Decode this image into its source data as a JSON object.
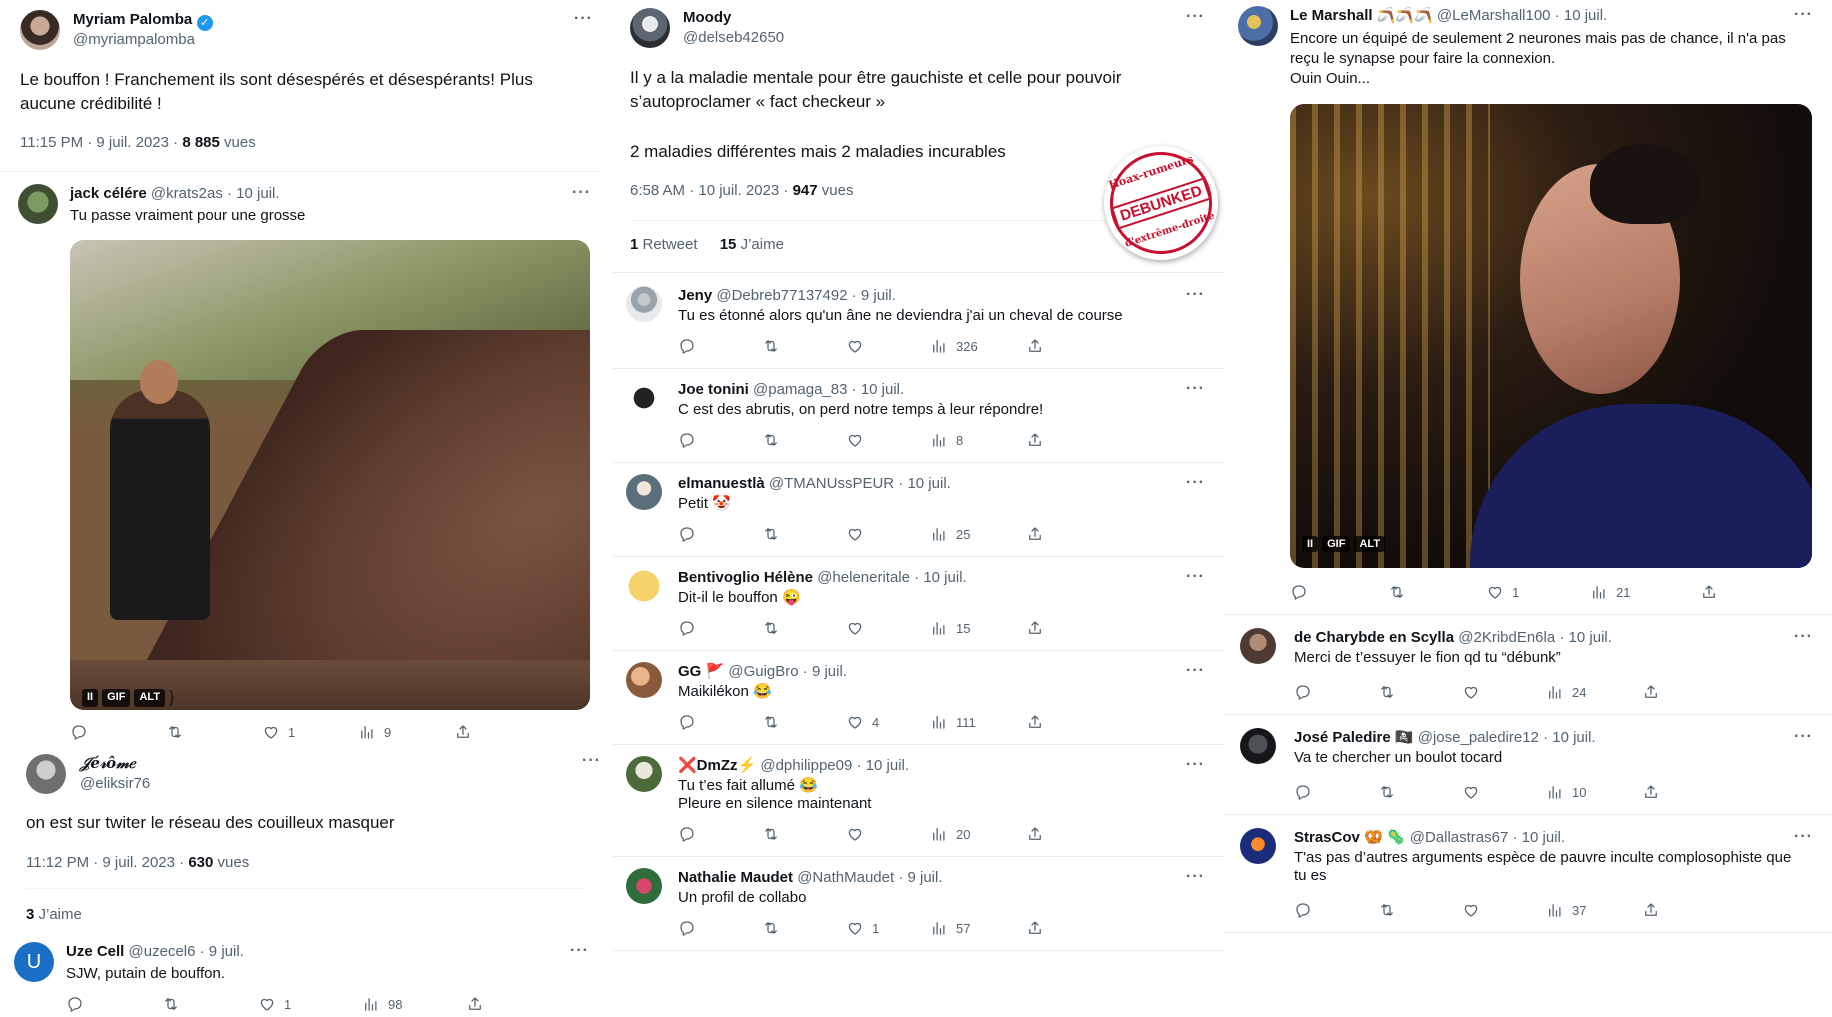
{
  "col1": {
    "main": {
      "name": "Myriam Palomba",
      "handle": "@myriampalomba",
      "text": "Le bouffon ! Franchement ils sont désespérés et désespérants! Plus aucune crédibilité !",
      "time": "11:15 PM · 9 juil. 2023 · ",
      "views_num": "8 885",
      "views_label": " vues"
    },
    "reply1": {
      "name": "jack célére",
      "handle": "@krats2as",
      "date": "· 10 juil.",
      "text": "Tu passe vraiment pour une grosse",
      "likes": "1",
      "views": "9",
      "badge": [
        "II",
        "GIF",
        "ALT"
      ]
    },
    "main2": {
      "name": "𝒥é𝓇ô𝓂𝑒",
      "handle": "@eliksir76",
      "text": "on est sur twiter le réseau des couilleux masquer",
      "time": "11:12 PM · 9 juil. 2023 · ",
      "views_num": "630",
      "views_label": " vues",
      "likes_num": "3",
      "likes_label": " J’aime"
    },
    "reply2": {
      "avatar_letter": "U",
      "name": "Uze Cell",
      "handle": "@uzecel6",
      "date": "· 9 juil.",
      "text": "SJW, putain de bouffon.",
      "likes": "1",
      "views": "98"
    }
  },
  "col2": {
    "main": {
      "name": "Moody",
      "handle": "@delseb42650",
      "text1": "Il y a la maladie mentale pour être gauchiste et celle pour pouvoir s’autoproclamer « fact checkeur »",
      "text2": "2 maladies différentes mais 2 maladies incurables",
      "time": "6:58 AM · 10 juil. 2023 · ",
      "views_num": "947",
      "views_label": " vues",
      "rt_num": "1",
      "rt_label": " Retweet",
      "likes_num": "15",
      "likes_label": " J’aime",
      "stamp_top": "Hoax-rumeurs",
      "stamp_mid": "DEBUNKED",
      "stamp_bot": "d'extrême-droite"
    },
    "replies": [
      {
        "name": "Jeny",
        "handle": "@Debreb77137492",
        "date": "· 9 juil.",
        "text": "Tu es étonné alors qu'un âne ne deviendra j'ai un cheval de course",
        "likes": "",
        "views": "326"
      },
      {
        "name": "Joe tonini",
        "handle": "@pamaga_83",
        "date": "· 10 juil.",
        "text": "C est des abrutis, on perd notre temps à leur répondre!",
        "likes": "",
        "views": "8"
      },
      {
        "name": "elmanuestlà",
        "handle": "@TMANUssPEUR",
        "date": "· 10 juil.",
        "text": "Petit 🤡",
        "likes": "",
        "views": "25"
      },
      {
        "name": "Bentivoglio Hélène",
        "handle": "@heleneritale",
        "date": "· 10 juil.",
        "text": "Dit-il le bouffon 😜",
        "likes": "",
        "views": "15"
      },
      {
        "name": "GG 🚩",
        "handle": "@GuigBro",
        "date": "· 9 juil.",
        "text": "Maikilékon 😂",
        "likes": "4",
        "views": "111"
      },
      {
        "name": "❌DmZz⚡",
        "handle": "@dphilippe09",
        "date": "· 10 juil.",
        "text": "Tu t’es fait allumé 😂",
        "text2": "Pleure en silence maintenant",
        "likes": "",
        "views": "20"
      },
      {
        "name": "Nathalie Maudet",
        "handle": "@NathMaudet",
        "date": "· 9 juil.",
        "text": "Un profil de collabo",
        "likes": "1",
        "views": "57"
      }
    ]
  },
  "col3": {
    "main": {
      "name": "Le Marshall 🪃🪃🪃",
      "handle": "@LeMarshall100",
      "date": "· 10 juil.",
      "text1": "Encore un équipé de seulement 2 neurones mais pas de chance, il n'a pas",
      "text2": "reçu le synapse pour faire la connexion.",
      "text3": "Ouin Ouin...",
      "likes": "1",
      "views": "21",
      "badge": [
        "II",
        "GIF",
        "ALT"
      ]
    },
    "replies": [
      {
        "name": "de Charybde en Scylla",
        "handle": "@2KribdEn6la",
        "date": "· 10 juil.",
        "text": "Merci de t’essuyer le fion qd tu “débunk”",
        "likes": "",
        "views": "24"
      },
      {
        "name": "José Paledire 🏴‍☠️",
        "handle": "@jose_paledire12",
        "date": "· 10 juil.",
        "text": "Va te chercher un boulot tocard",
        "likes": "",
        "views": "10"
      },
      {
        "name": "StrasCov 🥨 🦠",
        "handle": "@Dallastras67",
        "date": "· 10 juil.",
        "text": "T'as pas d’autres arguments espèce de pauvre inculte complosophiste que",
        "text2": "tu es",
        "likes": "",
        "views": "37"
      }
    ]
  }
}
